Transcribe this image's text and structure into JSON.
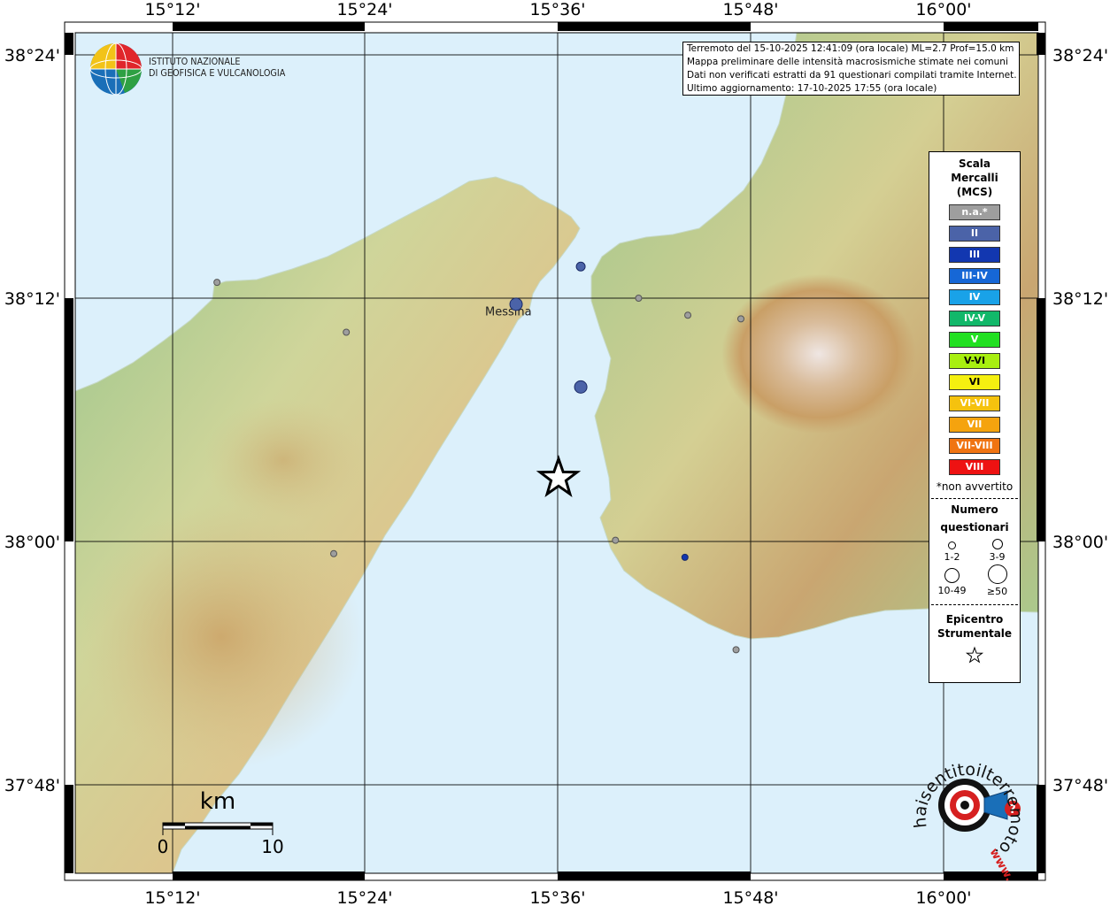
{
  "axes": {
    "lon_labels": [
      "15°12'",
      "15°24'",
      "15°36'",
      "15°48'",
      "16°00'"
    ],
    "lat_labels": [
      "38°24'",
      "38°12'",
      "38°00'",
      "37°48'"
    ]
  },
  "logo": {
    "line1": "ISTITUTO NAZIONALE",
    "line2": "DI GEOFISICA E VULCANOLOGIA"
  },
  "info": {
    "line1": "Terremoto del 15-10-2025 12:41:09 (ora locale) ML=2.7 Prof=15.0 km",
    "line2": "Mappa preliminare delle intensità macrosismiche stimate nei comuni",
    "line3": "Dati non verificati estratti da 91 questionari compilati tramite Internet.",
    "line4": "Ultimo aggiornamento: 17-10-2025 17:55 (ora locale)"
  },
  "legend": {
    "title1": "Scala",
    "title2": "Mercalli",
    "title3": "(MCS)",
    "scale": [
      {
        "label": "n.a.*",
        "color": "#9e9e9e"
      },
      {
        "label": "II",
        "color": "#4b63a8"
      },
      {
        "label": "III",
        "color": "#1237b0"
      },
      {
        "label": "III-IV",
        "color": "#1667d6"
      },
      {
        "label": "IV",
        "color": "#19a2e8"
      },
      {
        "label": "IV-V",
        "color": "#12b86a"
      },
      {
        "label": "V",
        "color": "#22e022"
      },
      {
        "label": "V-VI",
        "color": "#a8ef10"
      },
      {
        "label": "VI",
        "color": "#f5f010"
      },
      {
        "label": "VI-VII",
        "color": "#f5c20e"
      },
      {
        "label": "VII",
        "color": "#f5a30e"
      },
      {
        "label": "VII-VIII",
        "color": "#f07412"
      },
      {
        "label": "VIII",
        "color": "#ee1212"
      }
    ],
    "note": "*non avvertito",
    "count_title1": "Numero",
    "count_title2": "questionari",
    "counts": [
      "1-2",
      "3-9",
      "10-49",
      "≥50"
    ],
    "epicenter_title1": "Epicentro",
    "epicenter_title2": "Strumentale"
  },
  "scalebar": {
    "unit": "km",
    "min": "0",
    "max": "10"
  },
  "places": [
    {
      "name": "Messina",
      "lon": 15.556,
      "lat": 38.193
    }
  ],
  "epicenter": {
    "lon": 15.6,
    "lat": 38.052
  },
  "observations": [
    {
      "lon": 15.556,
      "lat": 38.195,
      "mcs": "II",
      "count": "10-49"
    },
    {
      "lon": 15.623,
      "lat": 38.127,
      "mcs": "II",
      "count": "10-49"
    },
    {
      "lon": 15.623,
      "lat": 38.226,
      "mcs": "II",
      "count": "3-9"
    },
    {
      "lon": 15.246,
      "lat": 38.213,
      "mcs": "n.a.*",
      "count": "1-2"
    },
    {
      "lon": 15.38,
      "lat": 38.172,
      "mcs": "n.a.*",
      "count": "1-2"
    },
    {
      "lon": 15.367,
      "lat": 37.99,
      "mcs": "n.a.*",
      "count": "1-2"
    },
    {
      "lon": 15.683,
      "lat": 38.2,
      "mcs": "n.a.*",
      "count": "1-2"
    },
    {
      "lon": 15.734,
      "lat": 38.186,
      "mcs": "n.a.*",
      "count": "1-2"
    },
    {
      "lon": 15.789,
      "lat": 38.183,
      "mcs": "n.a.*",
      "count": "1-2"
    },
    {
      "lon": 15.659,
      "lat": 38.001,
      "mcs": "n.a.*",
      "count": "1-2"
    },
    {
      "lon": 15.731,
      "lat": 37.987,
      "mcs": "III",
      "count": "1-2"
    },
    {
      "lon": 15.784,
      "lat": 37.911,
      "mcs": "n.a.*",
      "count": "1-2"
    }
  ],
  "watermark": {
    "text": "haisentitoilterremoto.it",
    "prefix": "www.",
    "accent": "#d62020"
  },
  "colors": {
    "sea": "#dcf0fb"
  }
}
